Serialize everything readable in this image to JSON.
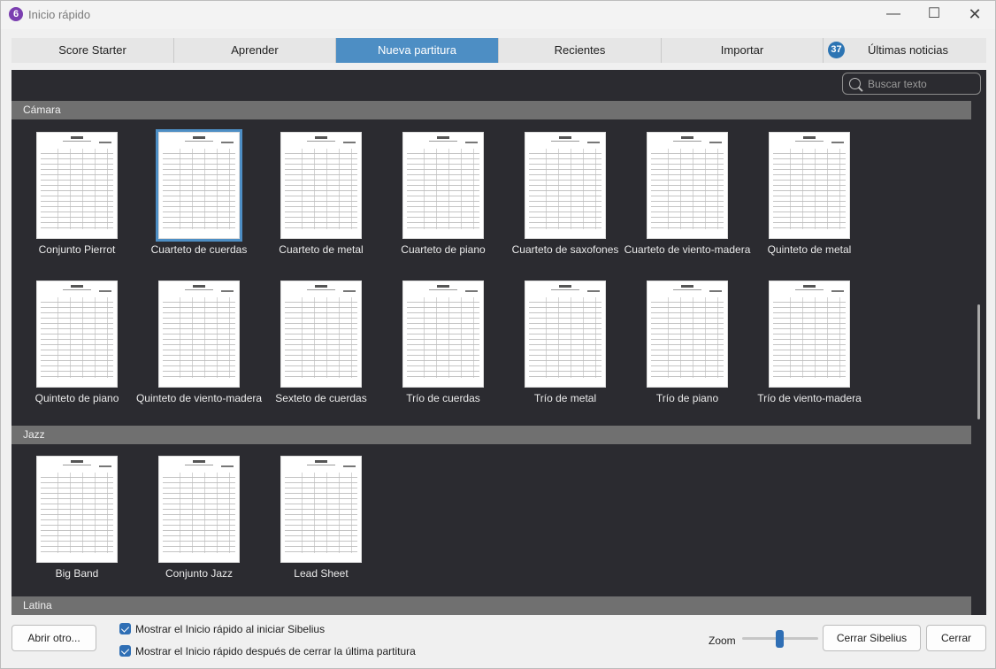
{
  "window": {
    "title": "Inicio rápido",
    "app_icon_glyph": "6",
    "minimize_glyph": "—",
    "maximize_glyph": "☐",
    "close_glyph": "✕"
  },
  "tabs": [
    {
      "label": "Score Starter"
    },
    {
      "label": "Aprender"
    },
    {
      "label": "Nueva partitura"
    },
    {
      "label": "Recientes"
    },
    {
      "label": "Importar"
    },
    {
      "label": "Últimas noticias",
      "badge": "37"
    }
  ],
  "search": {
    "placeholder": "Buscar texto"
  },
  "sections": [
    {
      "name": "Cámara",
      "templates": [
        "Conjunto Pierrot",
        "Cuarteto de cuerdas",
        "Cuarteto de metal",
        "Cuarteto de piano",
        "Cuarteto de saxofones",
        "Cuarteto de viento-madera",
        "Quinteto de metal",
        "Quinteto de piano",
        "Quinteto de viento-madera",
        "Sexteto de cuerdas",
        "Trío de cuerdas",
        "Trío de metal",
        "Trío de piano",
        "Trío de viento-madera"
      ]
    },
    {
      "name": "Jazz",
      "templates": [
        "Big Band",
        "Conjunto Jazz",
        "Lead Sheet"
      ]
    },
    {
      "name": "Latina",
      "templates": []
    }
  ],
  "selected_template": "Cuarteto de cuerdas",
  "footer": {
    "open_other_label": "Abrir otro...",
    "checkbox_startup": {
      "label": "Mostrar el Inicio rápido al iniciar Sibelius",
      "checked": true
    },
    "checkbox_after_close": {
      "label": "Mostrar el Inicio rápido después de cerrar la última partitura",
      "checked": true
    },
    "zoom_label": "Zoom",
    "zoom_level": 0.45,
    "close_sibelius_label": "Cerrar Sibelius",
    "close_label": "Cerrar"
  },
  "colors": {
    "accent": "#4d8ec4",
    "content_bg": "#2b2b30",
    "section_header": "#707070",
    "badge": "#2c74b3",
    "checkbox": "#2f6fb5"
  }
}
